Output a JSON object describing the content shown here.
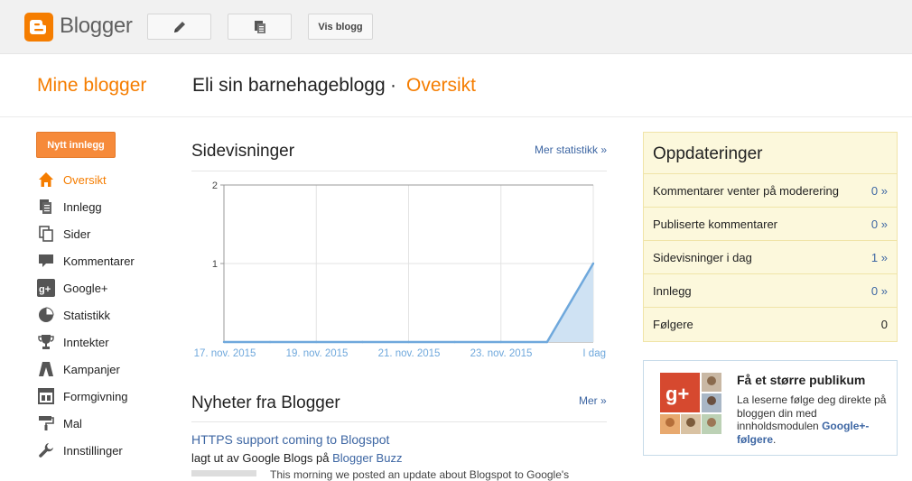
{
  "topbar": {
    "app_name": "Blogger",
    "logo_icon": "blogger-logo-icon",
    "edit_icon": "pencil-icon",
    "posts_icon": "documents-icon",
    "view_blog_label": "Vis blogg"
  },
  "header": {
    "my_blogs": "Mine blogger",
    "blog_title": "Eli sin barnehageblogg",
    "separator": "·",
    "current_page": "Oversikt"
  },
  "sidebar": {
    "new_post_label": "Nytt innlegg",
    "items": [
      {
        "label": "Oversikt",
        "icon": "home-icon",
        "active": true
      },
      {
        "label": "Innlegg",
        "icon": "posts-icon"
      },
      {
        "label": "Sider",
        "icon": "pages-icon"
      },
      {
        "label": "Kommentarer",
        "icon": "comment-icon"
      },
      {
        "label": "Google+",
        "icon": "google-plus-icon"
      },
      {
        "label": "Statistikk",
        "icon": "pie-chart-icon"
      },
      {
        "label": "Inntekter",
        "icon": "trophy-icon"
      },
      {
        "label": "Kampanjer",
        "icon": "campaign-icon"
      },
      {
        "label": "Formgivning",
        "icon": "layout-icon"
      },
      {
        "label": "Mal",
        "icon": "paint-roller-icon"
      },
      {
        "label": "Innstillinger",
        "icon": "wrench-icon"
      }
    ]
  },
  "pageviews": {
    "title": "Sidevisninger",
    "more_link": "Mer statistikk »"
  },
  "chart_data": {
    "type": "area",
    "x_tick_labels": [
      "17. nov. 2015",
      "19. nov. 2015",
      "21. nov. 2015",
      "23. nov. 2015",
      "I dag"
    ],
    "y_tick_labels": [
      "1",
      "2"
    ],
    "ylim": [
      0,
      2
    ],
    "series": [
      {
        "values": [
          0,
          0,
          0,
          0,
          0,
          0,
          0,
          0,
          1
        ]
      }
    ],
    "grid": true,
    "colors": {
      "line": "#6fa8dc",
      "fill": "#cfe2f3"
    }
  },
  "news": {
    "title": "Nyheter fra Blogger",
    "more_link": "Mer »",
    "items": [
      {
        "title": "HTTPS support coming to Blogspot",
        "meta_prefix": "lagt ut av Google Blogs på",
        "meta_link": "Blogger Buzz",
        "snippet": "This morning we posted an update about Blogspot to Google's"
      }
    ]
  },
  "updates": {
    "title": "Oppdateringer",
    "rows": [
      {
        "label": "Kommentarer venter på moderering",
        "value": "0 »",
        "link": true
      },
      {
        "label": "Publiserte kommentarer",
        "value": "0 »",
        "link": true
      },
      {
        "label": "Sidevisninger i dag",
        "value": "1 »",
        "link": true
      },
      {
        "label": "Innlegg",
        "value": "0 »",
        "link": true
      },
      {
        "label": "Følgere",
        "value": "0",
        "link": false
      }
    ]
  },
  "promo": {
    "title": "Få et større publikum",
    "text": "La leserne følge deg direkte på bloggen din med innholdsmodulen",
    "link": "Google+-følgere",
    "suffix": ".",
    "image_icon": "google-plus-avatars-icon"
  },
  "colors": {
    "accent": "#f57d00",
    "link": "#3d66a3",
    "button_orange": "#f68a3a",
    "updates_bg": "#fcf8dc"
  }
}
